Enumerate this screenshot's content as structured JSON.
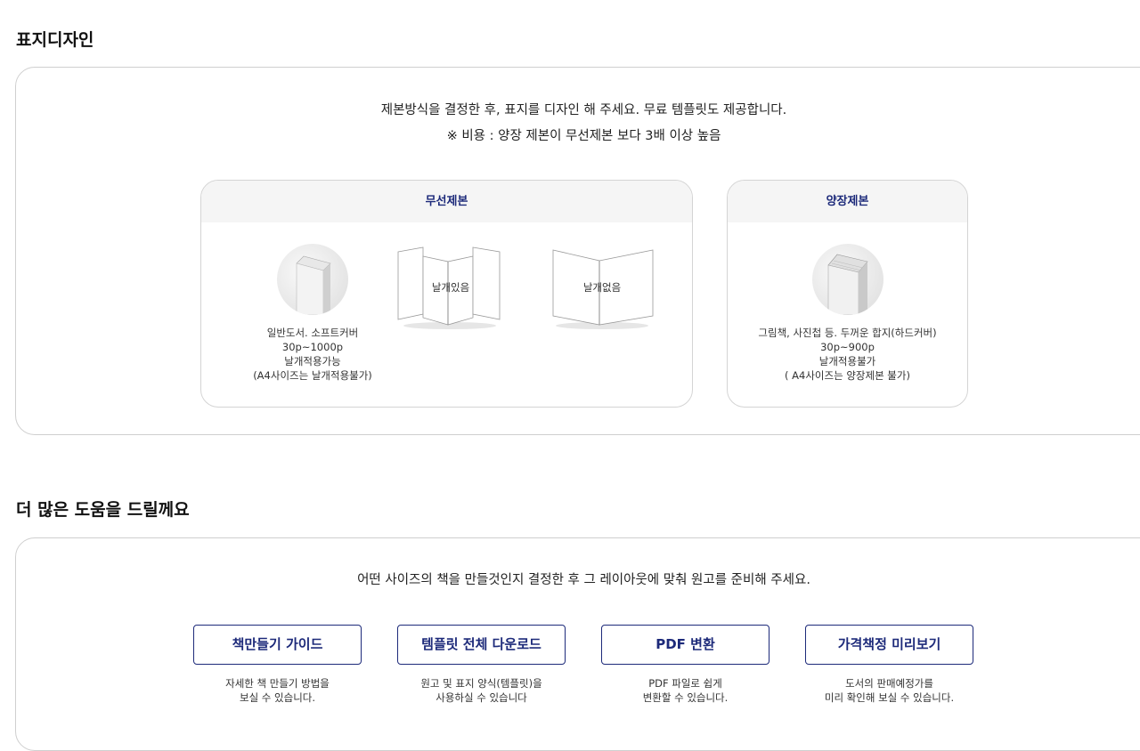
{
  "cover_section": {
    "title": "표지디자인",
    "intro_line1": "제본방식을 결정한 후, 표지를 디자인 해 주세요. 무료 템플릿도 제공합니다.",
    "intro_line2": "※ 비용 : 양장 제본이 무선제본 보다 3배 이상 높음",
    "perfect_binding": {
      "header": "무선제본",
      "desc_lines": [
        "일반도서. 소프트커버",
        "30p~1000p",
        "날개적용가능",
        "(A4사이즈는 날개적용불가)"
      ],
      "with_flaps_label": "날개있음",
      "without_flaps_label": "날개없음"
    },
    "hardcover": {
      "header": "양장제본",
      "desc_lines": [
        "그림책, 사진첩 등. 두꺼운 합지(하드커버)",
        "30p~900p",
        "날개적용불가",
        "( A4사이즈는 양장제본 불가)"
      ]
    }
  },
  "help_section": {
    "title": "더 많은 도움을 드릴께요",
    "intro": "어떤 사이즈의 책을 만들것인지 결정한 후 그 레이아웃에 맞춰 원고를 준비해 주세요.",
    "buttons": [
      {
        "label": "책만들기 가이드",
        "desc1": "자세한 책 만들기 방법을",
        "desc2": "보실 수 있습니다."
      },
      {
        "label": "템플릿 전체 다운로드",
        "desc1": "원고 및 표지 양식(템플릿)을",
        "desc2": "사용하실 수 있습니다"
      },
      {
        "label": "PDF 변환",
        "desc1": "PDF 파일로 쉽게",
        "desc2": "변환할 수 있습니다."
      },
      {
        "label": "가격책정 미리보기",
        "desc1": "도서의 판매예정가를",
        "desc2": "미리 확인해 보실 수 있습니다."
      }
    ]
  },
  "colors": {
    "accent": "#1d2a7a",
    "card_header_bg": "#f5f5f5",
    "border": "#cfcfcf"
  }
}
